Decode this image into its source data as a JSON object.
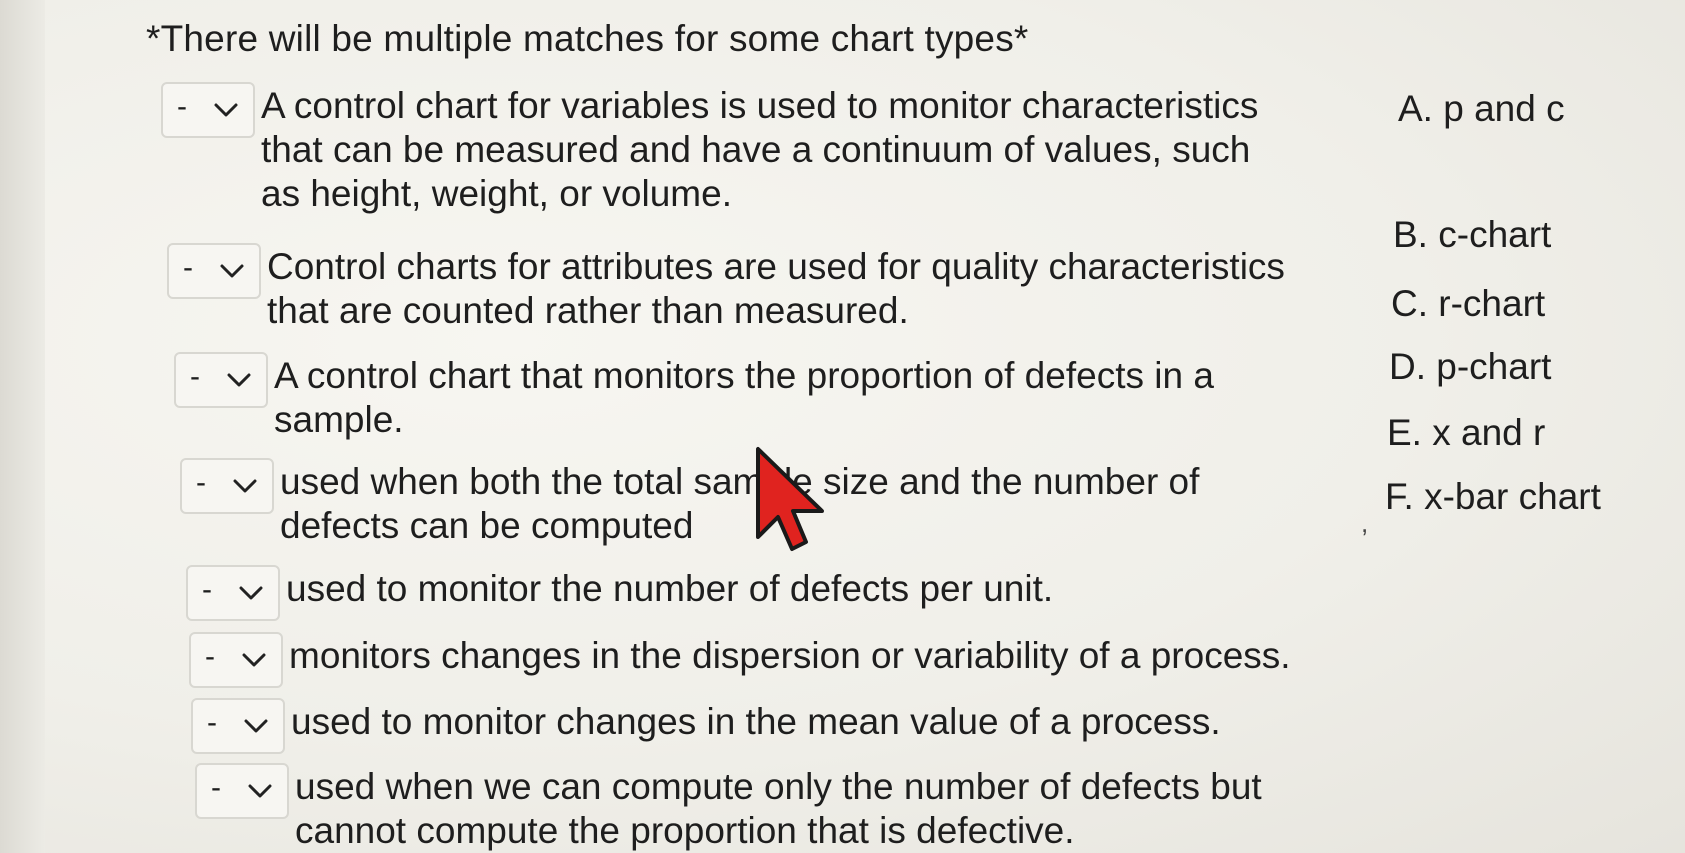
{
  "notice": "*There will be multiple matches for some chart types*",
  "questions": [
    {
      "selected": "-",
      "lines": [
        "A control chart for variables is used to monitor characteristics",
        "that can be measured and have a continuum of values, such",
        "as height, weight, or volume."
      ]
    },
    {
      "selected": "-",
      "lines": [
        "Control charts for attributes are used for quality characteristics",
        "that are counted rather than measured."
      ]
    },
    {
      "selected": "-",
      "lines": [
        "A control chart that monitors the proportion of defects in a",
        "sample."
      ]
    },
    {
      "selected": "-",
      "lines": [
        "used when both the total sample size and the number of",
        "defects can be computed"
      ]
    },
    {
      "selected": "-",
      "lines": [
        "used to monitor the number of defects per unit."
      ]
    },
    {
      "selected": "-",
      "lines": [
        "monitors changes in the dispersion or variability of a process."
      ]
    },
    {
      "selected": "-",
      "lines": [
        "used to monitor changes in the mean value of a process."
      ]
    },
    {
      "selected": "-",
      "lines": [
        "used when we can compute only the number of defects but",
        "cannot compute the proportion that is defective."
      ]
    }
  ],
  "answers": [
    {
      "letter": "A.",
      "text": "p and c"
    },
    {
      "letter": "B.",
      "text": "c-chart"
    },
    {
      "letter": "C.",
      "text": "r-chart"
    },
    {
      "letter": "D.",
      "text": "p-chart"
    },
    {
      "letter": "E.",
      "text": "x and r"
    },
    {
      "letter": "F.",
      "text": "x-bar chart"
    }
  ],
  "icons": {
    "dropdown": "chevron-down-icon",
    "pointer": "mouse-cursor-icon"
  },
  "colors": {
    "cursor_fill": "#e0231f",
    "cursor_outline": "#1a1a1a",
    "text": "#1e1e1e"
  }
}
